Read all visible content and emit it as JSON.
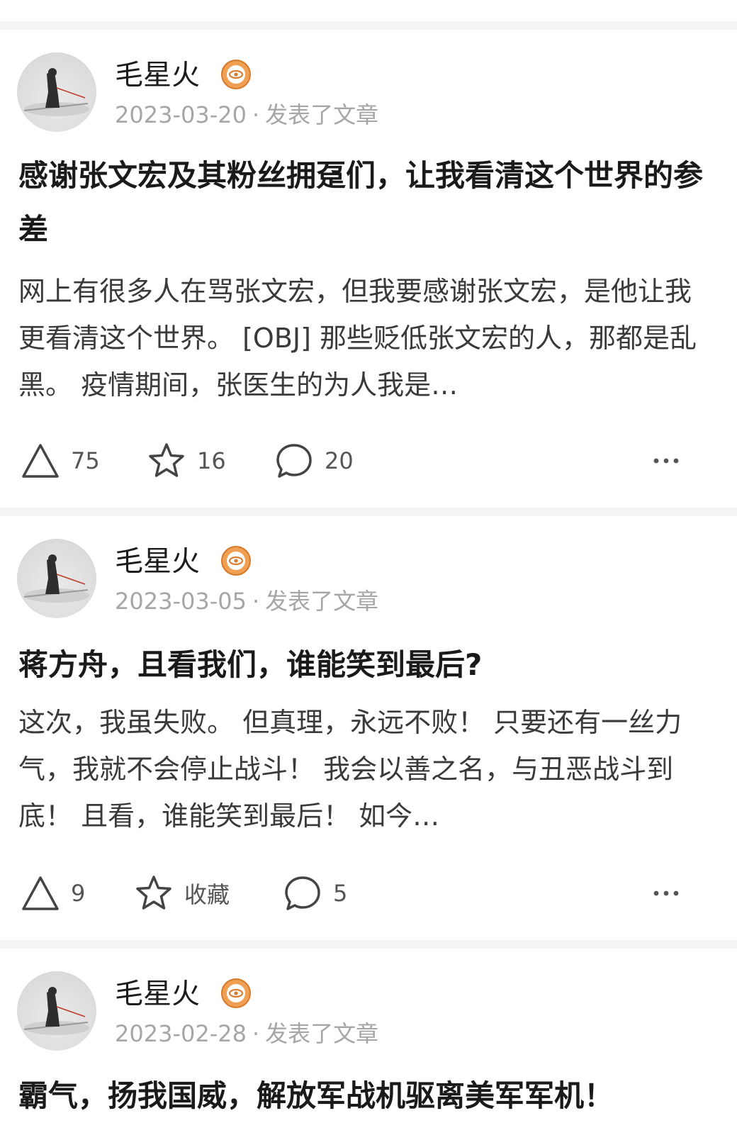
{
  "posts": [
    {
      "author": "毛星火",
      "date": "2023-03-20",
      "separator": "·",
      "action_text": "发表了文章",
      "title": "感谢张文宏及其粉丝拥趸们，让我看清这个世界的参差",
      "excerpt": "网上有很多人在骂张文宏，但我要感谢张文宏，是他让我更看清这个世界。 [OBJ] 那些贬低张文宏的人，那都是乱黑。 疫情期间，张医生的为人我是…",
      "like_count": "75",
      "favorite": "16",
      "comment_count": "20"
    },
    {
      "author": "毛星火",
      "date": "2023-03-05",
      "separator": "·",
      "action_text": "发表了文章",
      "title": "蒋方舟，且看我们，谁能笑到最后?",
      "excerpt": "这次，我虽失败。 但真理，永远不败！ 只要还有一丝力气，我就不会停止战斗！ 我会以善之名，与丑恶战斗到底！ 且看，谁能笑到最后！ 如今…",
      "like_count": "9",
      "favorite": "收藏",
      "comment_count": "5"
    },
    {
      "author": "毛星火",
      "date": "2023-02-28",
      "separator": "·",
      "action_text": "发表了文章",
      "title": "霸气，扬我国威，解放军战机驱离美军军机！"
    }
  ],
  "icons": {
    "like": "triangle-up-icon",
    "favorite": "star-icon",
    "comment": "speech-bubble-icon",
    "more": "ellipsis-icon",
    "badge": "eye-badge-icon"
  },
  "colors": {
    "badge": "#f0a052",
    "meta": "#a6a6a6",
    "divider": "#f4f4f4"
  }
}
